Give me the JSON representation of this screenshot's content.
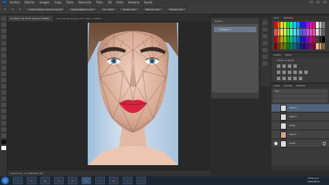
{
  "menubar": {
    "app_badge": "Ps",
    "items": [
      "Archivo",
      "Edición",
      "Imagen",
      "Capa",
      "Texto",
      "Selección",
      "Filtro",
      "3D",
      "Vista",
      "Ventana",
      "Ayuda"
    ]
  },
  "options_bar": {
    "field_1": "Limitar tamaño max para pincel",
    "button_1": "Ampliar/Reducir vent.",
    "button_2": "Px. reales",
    "button_3": "Ajustar pant.",
    "button_4": "Rellenar pant.",
    "button_5": "Tamaño impr."
  },
  "document": {
    "tab_active": "Sin título-1 @ 33,3% (Capa 2, RGB/8) *",
    "tab_inactive": "cara-divergente.jpg @ 25% (Capa 1, RGB/8) *"
  },
  "status_bar": {
    "text": "33,33%   Doc: 13,2 MB/168,2 MB"
  },
  "navigator_panel": {
    "title": "Historia",
    "item": "Triángulo 1"
  },
  "swatches_panel": {
    "tabs": [
      "Color",
      "Muestras"
    ],
    "colors": [
      "#ff0000",
      "#ff6a00",
      "#ffd800",
      "#b6ff00",
      "#00ff21",
      "#00ffbb",
      "#00d8ff",
      "#0094ff",
      "#0026ff",
      "#4800ff",
      "#b200ff",
      "#ff00dc",
      "#ff006e",
      "#ffffff",
      "#c0c0c0",
      "#808080",
      "#ff4b4b",
      "#ff8c4b",
      "#ffe14b",
      "#c8ff4b",
      "#4bff60",
      "#4bffcc",
      "#4be1ff",
      "#4bb0ff",
      "#4b63ff",
      "#7f4bff",
      "#c84bff",
      "#ff4be6",
      "#ff4b99",
      "#e0e0e0",
      "#a0a0a0",
      "#606060",
      "#c00000",
      "#c05000",
      "#c0a000",
      "#88c000",
      "#00c018",
      "#00c08c",
      "#00a0c0",
      "#0070c0",
      "#001cc0",
      "#3600c0",
      "#8600c0",
      "#c000a8",
      "#c00052",
      "#404040",
      "#202020",
      "#000000",
      "#800000",
      "#803500",
      "#806b00",
      "#5b8000",
      "#008010",
      "#00805d",
      "#006b80",
      "#004a80",
      "#001380",
      "#240080",
      "#590080",
      "#800070",
      "#800036",
      "#f6c089",
      "#c69c6d",
      "#8c6239"
    ]
  },
  "adjustments_panel": {
    "tabs": [
      "Ajustes",
      "Estilos"
    ],
    "subtitle": "Añadir un ajuste"
  },
  "layers_panel": {
    "tabs": [
      "Capas",
      "Canales",
      "Trazados"
    ],
    "kind_label": "Tipo",
    "layers": [
      {
        "name": "Capa 2",
        "selected": true,
        "visible": false
      },
      {
        "name": "Capa 3",
        "selected": false,
        "visible": false
      },
      {
        "name": "Verde",
        "selected": false,
        "visible": false
      },
      {
        "name": "Capa 1",
        "selected": false,
        "visible": false
      },
      {
        "name": "Fondo",
        "selected": false,
        "visible": true
      }
    ]
  },
  "taskbar": {
    "time": "23:51 p.m.",
    "date": "25/07/2014",
    "apps": [
      "IE",
      "Explorer",
      "Media",
      "Chrome",
      "AI",
      "PS",
      "Word",
      "Firefox",
      "Excel",
      "Skype"
    ]
  }
}
